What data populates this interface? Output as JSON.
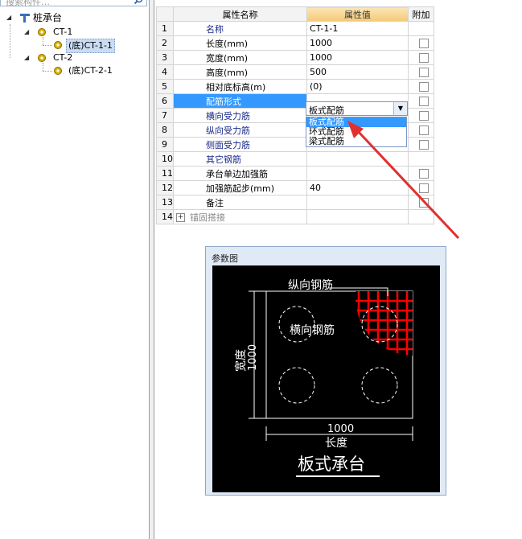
{
  "tree": {
    "search_placeholder": "搜索构件…",
    "root": "桩承台",
    "nodes": [
      {
        "label": "CT-1",
        "child": "(底)CT-1-1",
        "child_selected": true
      },
      {
        "label": "CT-2",
        "child": "(底)CT-2-1",
        "child_selected": false
      }
    ]
  },
  "grid": {
    "headers": {
      "name": "属性名称",
      "value": "属性值",
      "extra": "附加"
    },
    "rows": [
      {
        "n": "1",
        "name": "名称",
        "value": "CT-1-1"
      },
      {
        "n": "2",
        "name": "长度(mm)",
        "value": "1000"
      },
      {
        "n": "3",
        "name": "宽度(mm)",
        "value": "1000"
      },
      {
        "n": "4",
        "name": "高度(mm)",
        "value": "500"
      },
      {
        "n": "5",
        "name": "相对底标高(m)",
        "value": "(0)"
      },
      {
        "n": "6",
        "name": "配筋形式",
        "value": "板式配筋"
      },
      {
        "n": "7",
        "name": "横向受力筋",
        "value": ""
      },
      {
        "n": "8",
        "name": "纵向受力筋",
        "value": ""
      },
      {
        "n": "9",
        "name": "侧面受力筋",
        "value": ""
      },
      {
        "n": "10",
        "name": "其它钢筋",
        "value": ""
      },
      {
        "n": "11",
        "name": "承台单边加强筋",
        "value": ""
      },
      {
        "n": "12",
        "name": "加强筋起步(mm)",
        "value": "40"
      },
      {
        "n": "13",
        "name": "备注",
        "value": ""
      },
      {
        "n": "14",
        "name": "锚固搭接",
        "value": ""
      }
    ],
    "dropdown_options": [
      "板式配筋",
      "环式配筋",
      "梁式配筋"
    ]
  },
  "param_window": {
    "title": "参数图",
    "label_long_rebar": "纵向钢筋",
    "label_trans_rebar": "横向钢筋",
    "label_width": "宽度",
    "width_value": "1000",
    "length_value": "1000",
    "label_length": "长度",
    "caption": "板式承台"
  },
  "colors": {
    "accent": "#3399ff",
    "rebar": "#ff0000",
    "arrow": "#e03030"
  }
}
